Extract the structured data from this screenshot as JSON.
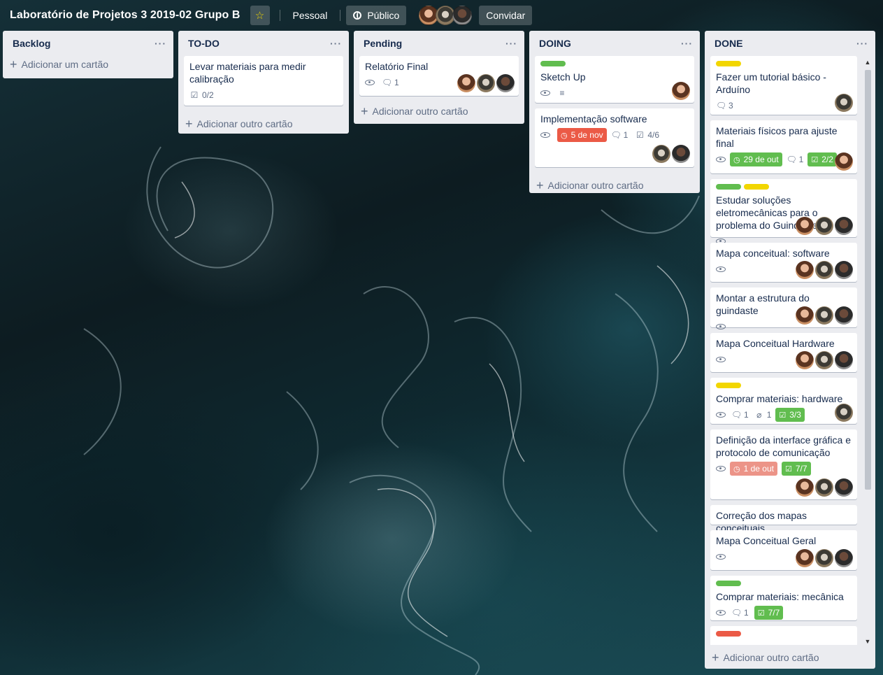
{
  "header": {
    "board_title": "Laboratório de Projetos 3 2019-02 Grupo B",
    "star_icon": "star-icon",
    "team": "Pessoal",
    "visibility": "Público",
    "invite": "Convidar",
    "members": [
      "member-1",
      "member-2",
      "member-3"
    ]
  },
  "colors": {
    "green": "#61bd4f",
    "yellow": "#f2d600",
    "red": "#eb5a46"
  },
  "lists": {
    "backlog": {
      "name": "Backlog",
      "add": "Adicionar um cartão"
    },
    "todo": {
      "name": "TO-DO",
      "add": "Adicionar outro cartão",
      "cards": [
        {
          "title": "Levar materiais para medir calibração",
          "checklist": "0/2"
        }
      ]
    },
    "pending": {
      "name": "Pending",
      "add": "Adicionar outro cartão",
      "cards": [
        {
          "title": "Relatório Final",
          "comments": "1"
        }
      ]
    },
    "doing": {
      "name": "DOING",
      "add": "Adicionar outro cartão",
      "cards": [
        {
          "title": "Sketch Up",
          "labels": [
            "green"
          ]
        },
        {
          "title": "Implementação software",
          "due": "5 de nov",
          "comments": "1",
          "checklist": "4/6"
        }
      ]
    },
    "done": {
      "name": "DONE",
      "add": "Adicionar outro cartão",
      "cards": [
        {
          "title": "Fazer um tutorial básico - Arduíno",
          "labels": [
            "yellow"
          ],
          "comments": "3"
        },
        {
          "title": "Materiais físicos para ajuste final",
          "due": "29 de out",
          "comments": "1",
          "checklist": "2/2"
        },
        {
          "title": "Estudar soluções eletromecânicas para o problema do Guindaste",
          "labels": [
            "green",
            "yellow"
          ]
        },
        {
          "title": "Mapa conceitual: software"
        },
        {
          "title": "Montar a estrutura do guindaste"
        },
        {
          "title": "Mapa Conceitual Hardware"
        },
        {
          "title": "Comprar materiais: hardware",
          "labels": [
            "yellow"
          ],
          "comments": "1",
          "attachments": "1",
          "checklist": "3/3"
        },
        {
          "title": "Definição da interface gráfica e protocolo de comunicação",
          "due": "1 de out",
          "checklist": "7/7"
        },
        {
          "title": "Correção dos mapas conceituais"
        },
        {
          "title": "Mapa Conceitual Geral"
        },
        {
          "title": "Comprar materiais: mecânica",
          "labels": [
            "green"
          ],
          "comments": "1",
          "checklist": "7/7"
        },
        {
          "title": "",
          "labels": [
            "red"
          ]
        }
      ]
    }
  }
}
